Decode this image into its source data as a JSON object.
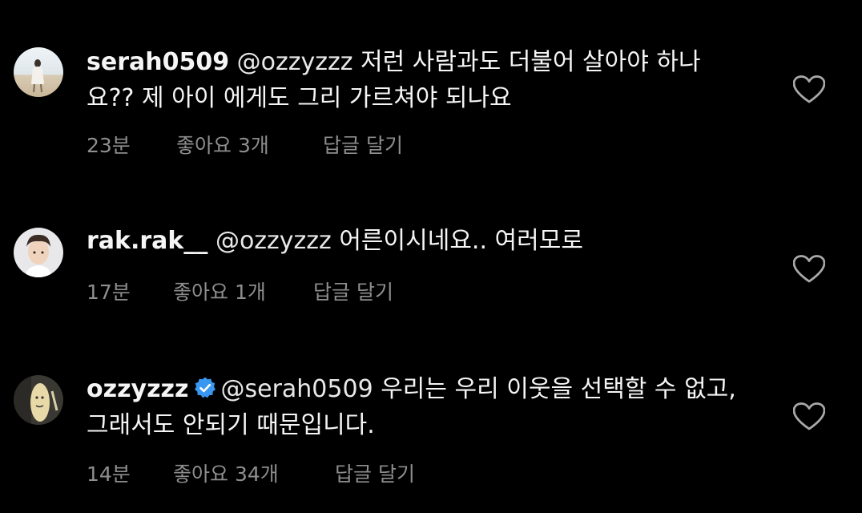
{
  "comments": [
    {
      "username": "serah0509",
      "verified": false,
      "mention": "@ozzyzzz",
      "text": " 저런 사람과도 더불어 살아야 하나요?? 제 아이 에게도 그리 가르쳐야 되나요",
      "time": "23분",
      "likes": "좋아요 3개",
      "reply": "답글 달기"
    },
    {
      "username": "rak.rak__",
      "verified": false,
      "mention": "@ozzyzzz",
      "text": " 어른이시네요.. 여러모로",
      "time": "17분",
      "likes": "좋아요 1개",
      "reply": "답글 달기"
    },
    {
      "username": "ozzyzzz",
      "verified": true,
      "mention": "@serah0509",
      "text": " 우리는 우리 이웃을 선택할 수 없고, 그래서도 안되기 때문입니다.",
      "time": "14분",
      "likes": "좋아요 34개",
      "reply": "답글 달기"
    }
  ],
  "icons": {
    "like": "heart-outline-icon",
    "verified": "verified-badge-icon"
  },
  "colors": {
    "background": "#000000",
    "text": "#f5f5f5",
    "meta": "#8e8e8e",
    "verified": "#3897f0"
  }
}
